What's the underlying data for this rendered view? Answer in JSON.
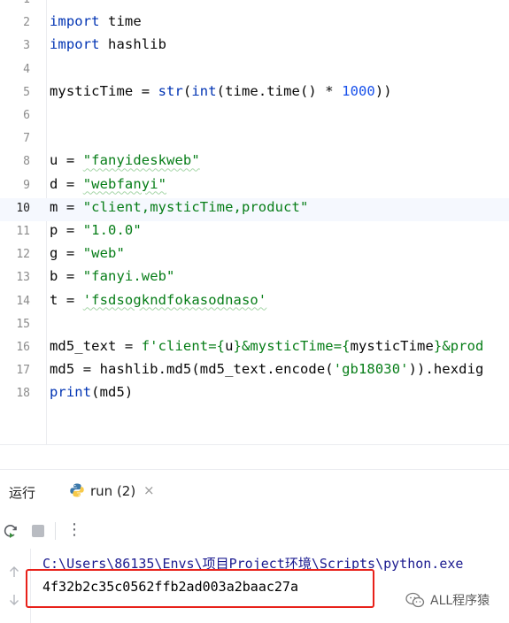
{
  "editor": {
    "current_line": 10,
    "lines": [
      {
        "n": "1",
        "tokens": []
      },
      {
        "n": "2",
        "tokens": [
          {
            "t": "import",
            "c": "kw"
          },
          {
            "t": " time",
            "c": ""
          }
        ]
      },
      {
        "n": "3",
        "tokens": [
          {
            "t": "import",
            "c": "kw"
          },
          {
            "t": " hashlib",
            "c": ""
          }
        ]
      },
      {
        "n": "4",
        "tokens": []
      },
      {
        "n": "5",
        "tokens": [
          {
            "t": "mysticTime = ",
            "c": ""
          },
          {
            "t": "str",
            "c": "kw"
          },
          {
            "t": "(",
            "c": ""
          },
          {
            "t": "int",
            "c": "kw"
          },
          {
            "t": "(time.time() * ",
            "c": ""
          },
          {
            "t": "1000",
            "c": "num"
          },
          {
            "t": "))",
            "c": ""
          }
        ]
      },
      {
        "n": "6",
        "tokens": []
      },
      {
        "n": "7",
        "tokens": []
      },
      {
        "n": "8",
        "tokens": [
          {
            "t": "u = ",
            "c": ""
          },
          {
            "t": "\"fanyideskweb\"",
            "c": "str squig"
          }
        ]
      },
      {
        "n": "9",
        "tokens": [
          {
            "t": "d = ",
            "c": ""
          },
          {
            "t": "\"webfanyi\"",
            "c": "str squig"
          }
        ]
      },
      {
        "n": "10",
        "tokens": [
          {
            "t": "m = ",
            "c": ""
          },
          {
            "t": "\"client,mysticTime,product\"",
            "c": "str"
          }
        ]
      },
      {
        "n": "11",
        "tokens": [
          {
            "t": "p = ",
            "c": ""
          },
          {
            "t": "\"1.0.0\"",
            "c": "str"
          }
        ]
      },
      {
        "n": "12",
        "tokens": [
          {
            "t": "g = ",
            "c": ""
          },
          {
            "t": "\"web\"",
            "c": "str"
          }
        ]
      },
      {
        "n": "13",
        "tokens": [
          {
            "t": "b = ",
            "c": ""
          },
          {
            "t": "\"fanyi.web\"",
            "c": "str"
          }
        ]
      },
      {
        "n": "14",
        "tokens": [
          {
            "t": "t = ",
            "c": ""
          },
          {
            "t": "'fsdsogkndfokasodnaso'",
            "c": "str squig"
          }
        ]
      },
      {
        "n": "15",
        "tokens": []
      },
      {
        "n": "16",
        "tokens": [
          {
            "t": "md5_text = ",
            "c": ""
          },
          {
            "t": "f'client={",
            "c": "str"
          },
          {
            "t": "u",
            "c": ""
          },
          {
            "t": "}&mysticTime={",
            "c": "str"
          },
          {
            "t": "mysticTime",
            "c": ""
          },
          {
            "t": "}&prod",
            "c": "str"
          }
        ]
      },
      {
        "n": "17",
        "tokens": [
          {
            "t": "md5 = hashlib.md5(md5_text.encode(",
            "c": ""
          },
          {
            "t": "'gb18030'",
            "c": "str"
          },
          {
            "t": ")).hexdig",
            "c": ""
          }
        ]
      },
      {
        "n": "18",
        "tokens": [
          {
            "t": "print",
            "c": "kw"
          },
          {
            "t": "(md5)",
            "c": ""
          }
        ]
      }
    ]
  },
  "panel": {
    "title": "运行",
    "tab_label": "run (2)",
    "tab_close": "×",
    "tab_icon": "python-icon"
  },
  "toolbar": {
    "buttons": [
      "rerun-icon",
      "stop-icon",
      "more-vertical-icon"
    ],
    "more_glyph": "⋮"
  },
  "console": {
    "command": "C:\\Users\\86135\\Envs\\项目Project环境\\Scripts\\python.exe",
    "output": "4f32b2c35c0562ffb2ad003a2baac27a",
    "highlight_color": "#e8211a"
  },
  "watermark": {
    "text": "ALL程序猿",
    "icon": "wechat-icon"
  },
  "colors": {
    "keyword": "#0033b3",
    "string": "#067d17",
    "number": "#1750eb",
    "accent": "#3574f0"
  }
}
